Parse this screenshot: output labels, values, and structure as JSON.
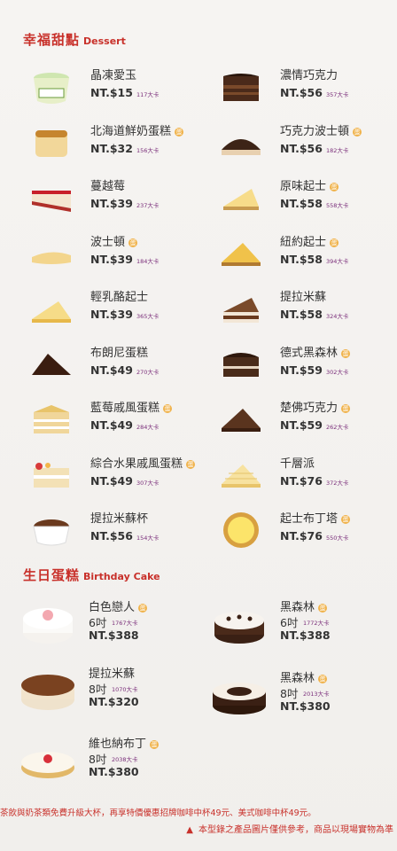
{
  "sections": {
    "dessert": {
      "title": "幸福甜點",
      "title_en": "Dessert"
    },
    "birthday": {
      "title": "生日蛋糕",
      "title_en": "Birthday Cake"
    }
  },
  "badge_label": "蛋",
  "desserts": [
    {
      "name": "晶凍愛玉",
      "price": "NT.$15",
      "kcal": "117大卡",
      "badge": false,
      "icon": "jelly-cup-icon"
    },
    {
      "name": "濃情巧克力",
      "price": "NT.$56",
      "kcal": "357大卡",
      "badge": false,
      "icon": "chocolate-cake-icon"
    },
    {
      "name": "北海道鮮奶蛋糕",
      "price": "NT.$32",
      "kcal": "156大卡",
      "badge": true,
      "icon": "milk-cake-icon"
    },
    {
      "name": "巧克力波士頓",
      "price": "NT.$56",
      "kcal": "182大卡",
      "badge": true,
      "icon": "chocolate-boston-icon"
    },
    {
      "name": "蔓越莓",
      "price": "NT.$39",
      "kcal": "237大卡",
      "badge": false,
      "icon": "cranberry-cake-icon"
    },
    {
      "name": "原味起士",
      "price": "NT.$58",
      "kcal": "558大卡",
      "badge": true,
      "icon": "cheesecake-icon"
    },
    {
      "name": "波士頓",
      "price": "NT.$39",
      "kcal": "184大卡",
      "badge": true,
      "icon": "boston-cake-icon"
    },
    {
      "name": "紐約起士",
      "price": "NT.$58",
      "kcal": "394大卡",
      "badge": true,
      "icon": "new-york-cheesecake-icon"
    },
    {
      "name": "輕乳酪起士",
      "price": "NT.$39",
      "kcal": "365大卡",
      "badge": false,
      "icon": "light-cheese-icon"
    },
    {
      "name": "提拉米蘇",
      "price": "NT.$58",
      "kcal": "324大卡",
      "badge": false,
      "icon": "tiramisu-icon"
    },
    {
      "name": "布朗尼蛋糕",
      "price": "NT.$49",
      "kcal": "270大卡",
      "badge": false,
      "icon": "brownie-icon"
    },
    {
      "name": "德式黑森林",
      "price": "NT.$59",
      "kcal": "302大卡",
      "badge": true,
      "icon": "black-forest-slice-icon"
    },
    {
      "name": "藍莓戚風蛋糕",
      "price": "NT.$49",
      "kcal": "284大卡",
      "badge": true,
      "icon": "blueberry-chiffon-icon"
    },
    {
      "name": "楚佛巧克力",
      "price": "NT.$59",
      "kcal": "262大卡",
      "badge": true,
      "icon": "truffle-chocolate-icon"
    },
    {
      "name": "綜合水果戚風蛋糕",
      "price": "NT.$49",
      "kcal": "307大卡",
      "badge": true,
      "icon": "fruit-chiffon-icon"
    },
    {
      "name": "千層派",
      "price": "NT.$76",
      "kcal": "372大卡",
      "badge": false,
      "icon": "mille-crepe-icon"
    },
    {
      "name": "提拉米蘇杯",
      "price": "NT.$56",
      "kcal": "154大卡",
      "badge": false,
      "icon": "tiramisu-cup-icon"
    },
    {
      "name": "起士布丁塔",
      "price": "NT.$76",
      "kcal": "550大卡",
      "badge": true,
      "icon": "cheese-pudding-tart-icon"
    }
  ],
  "birthday_cakes": [
    {
      "name": "白色戀人",
      "size": "6吋",
      "kcal": "1767大卡",
      "price": "NT.$388",
      "badge": true,
      "icon": "white-lover-cake-icon"
    },
    {
      "name": "黑森林",
      "size": "6吋",
      "kcal": "1772大卡",
      "price": "NT.$388",
      "badge": true,
      "icon": "black-forest-cake-icon"
    },
    {
      "name": "提拉米蘇",
      "size": "8吋",
      "kcal": "1070大卡",
      "price": "NT.$320",
      "badge": false,
      "icon": "tiramisu-cake-icon"
    },
    {
      "name": "黑森林",
      "size": "8吋",
      "kcal": "2013大卡",
      "price": "NT.$380",
      "badge": true,
      "icon": "black-forest-8-cake-icon"
    },
    {
      "name": "維也納布丁",
      "size": "8吋",
      "kcal": "2038大卡",
      "price": "NT.$380",
      "badge": true,
      "icon": "vienna-pudding-cake-icon"
    }
  ],
  "footer": {
    "note1": "茶飲與奶茶類免費升級大杯，再享特價優惠招牌咖啡中杯49元、美式咖啡中杯49元。",
    "note2": "本型錄之產品圖片僅供參考，商品以現場實物為準"
  },
  "colors": {
    "accent": "#c8302a",
    "badge": "#f0b24a",
    "kcal": "#7a2e7a"
  }
}
